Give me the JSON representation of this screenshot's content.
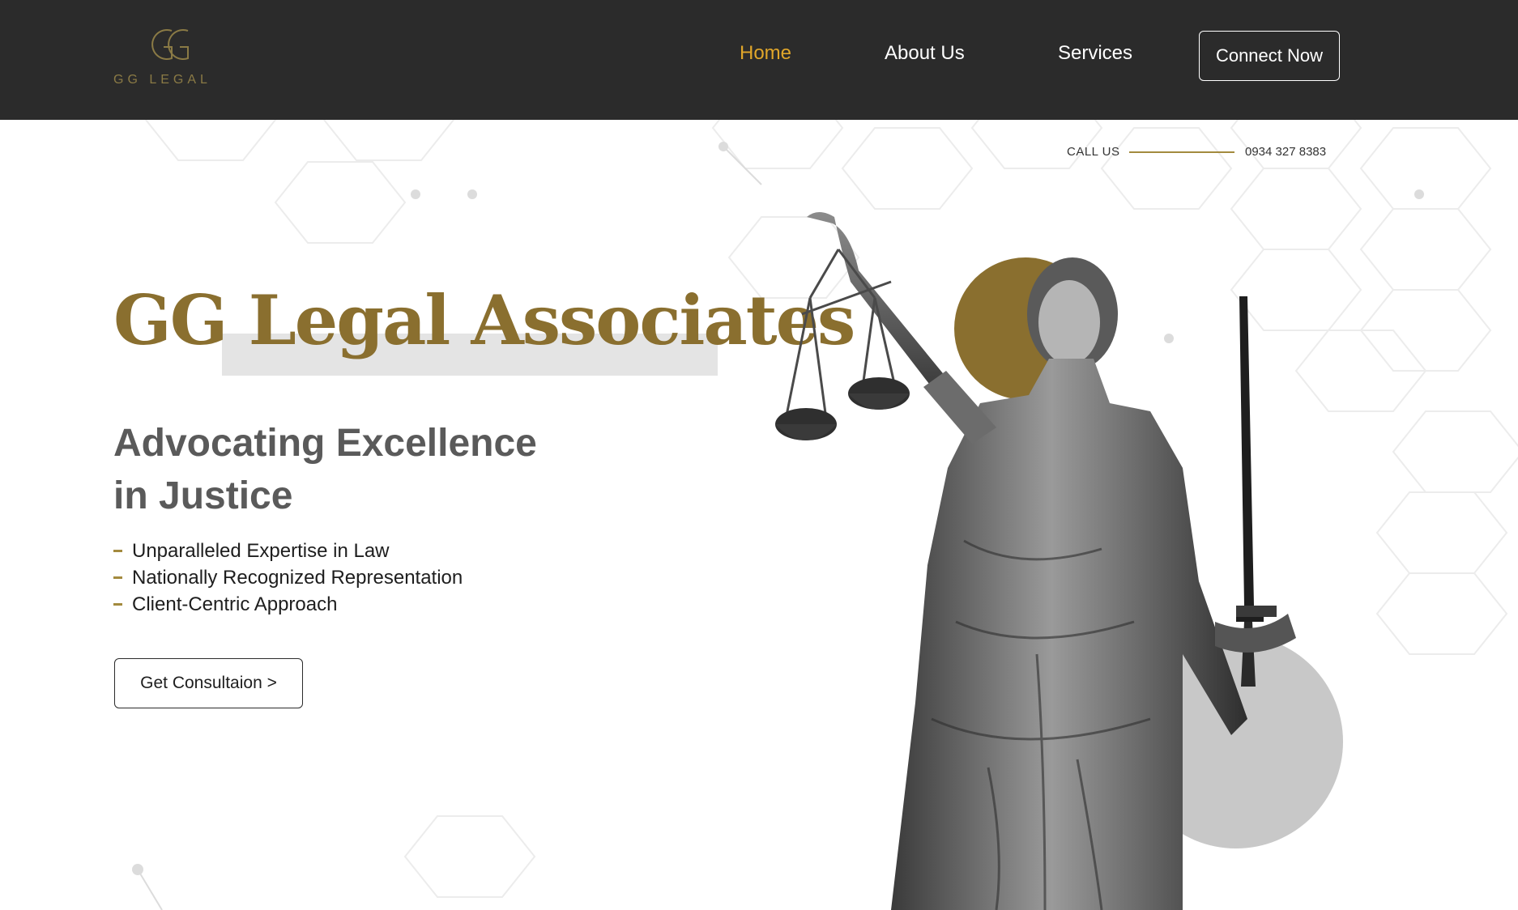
{
  "header": {
    "logo_text": "GG LEGAL",
    "nav": [
      {
        "label": "Home",
        "active": true
      },
      {
        "label": "About Us",
        "active": false
      },
      {
        "label": "Services",
        "active": false
      }
    ],
    "connect_label": "Connect Now"
  },
  "contact": {
    "call_label": "CALL US",
    "phone": "0934 327 8383"
  },
  "hero": {
    "title": "GG Legal Associates",
    "subtitle_line1": "Advocating Excellence",
    "subtitle_line2": "in Justice",
    "features": [
      "Unparalleled Expertise in Law",
      "Nationally Recognized Representation",
      "Client-Centric Approach"
    ],
    "cta_label": "Get Consultaion >"
  },
  "images": {
    "statue": "lady-justice-statue"
  },
  "colors": {
    "header_bg": "#2b2b2b",
    "accent_gold": "#8a6f2f",
    "active_nav": "#e0a62a",
    "gray_circle": "#c8c8c8"
  }
}
